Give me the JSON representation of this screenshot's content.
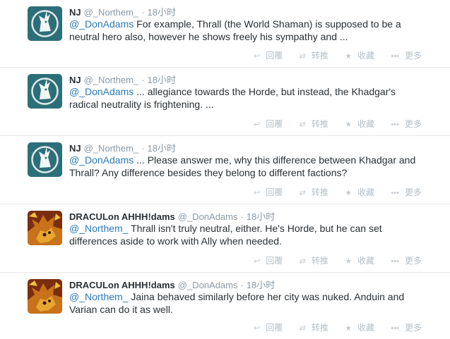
{
  "actions": {
    "reply_icon": "reply-icon",
    "reply_label": "回覆",
    "retweet_icon": "retweet-icon",
    "retweet_label": "转推",
    "favorite_icon": "star-icon",
    "favorite_label": "收藏",
    "more_icon": "more-icon",
    "more_label": "更多"
  },
  "tweets": [
    {
      "fullname": "NJ",
      "username": "@_Northem_",
      "dot": "·",
      "time": "18小时",
      "mention": "@_DonAdams",
      "text": " For example, Thrall (the World Shaman) is supposed to be a neutral hero also, however he shows freely his sympathy and ..."
    },
    {
      "fullname": "NJ",
      "username": "@_Northem_",
      "dot": "·",
      "time": "18小时",
      "mention": "@_DonAdams",
      "text": " ... allegiance towards the Horde, but instead, the Khadgar's radical neutrality is frightening. ..."
    },
    {
      "fullname": "NJ",
      "username": "@_Northem_",
      "dot": "·",
      "time": "18小时",
      "mention": "@_DonAdams",
      "text": " ... Please answer me, why this difference between Khadgar and Thrall? Any difference besides they belong to different factions?"
    },
    {
      "fullname": "DRACULon AHHH!dams",
      "username": "@_DonAdams",
      "dot": "·",
      "time": "18小时",
      "mention": "@_Northem_",
      "text": "  Thrall isn't truly neutral, either. He's Horde, but he can set differences aside to work with Ally when needed."
    },
    {
      "fullname": "DRACULon AHHH!dams",
      "username": "@_DonAdams",
      "dot": "·",
      "time": "18小时",
      "mention": "@_Northem_",
      "text": "  Jaina behaved similarly before her city was nuked. Anduin and Varian can do it as well."
    }
  ],
  "colors": {
    "link": "#2b7bb9",
    "meta": "#8899a6",
    "nj_avatar_bg": "#2d6f78",
    "dragon_avatar_bg": "#c8721c"
  }
}
